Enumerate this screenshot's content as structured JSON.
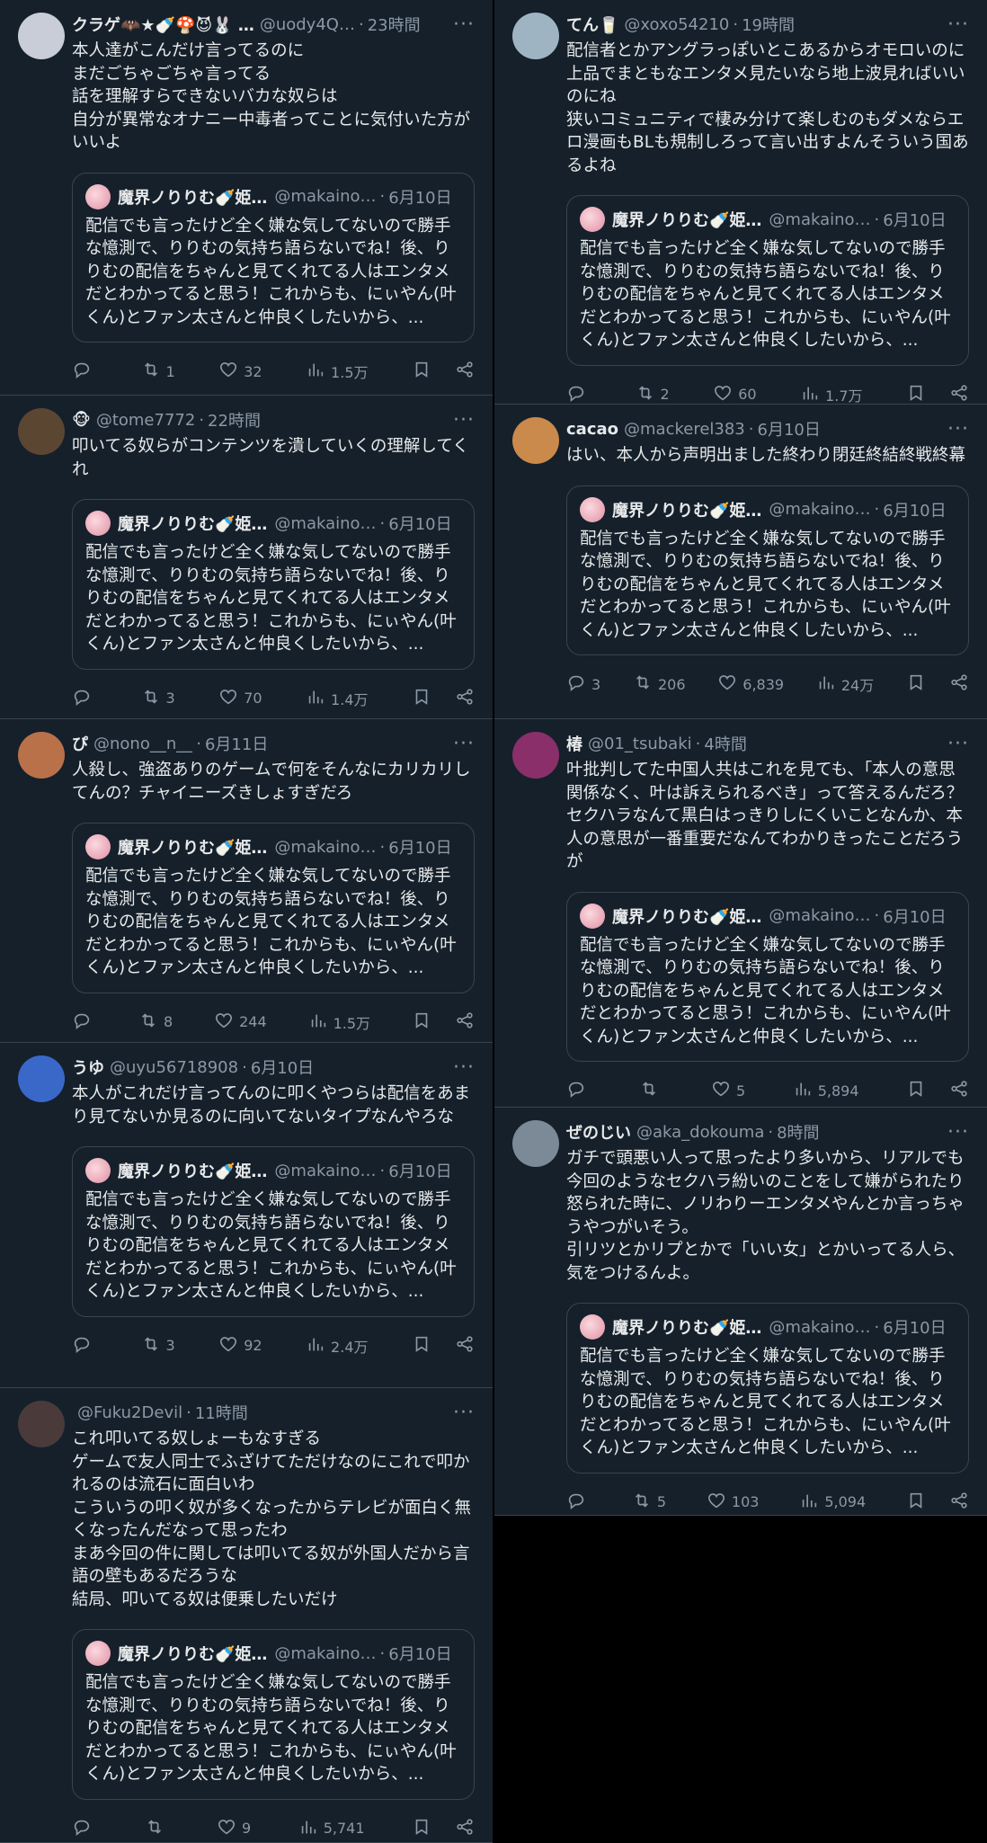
{
  "quote": {
    "name": "魔界ノりりむ🍼姫…",
    "handle": "@makaino…",
    "time": "6月10日",
    "body": "配信でも言ったけど全く嫌な気してないので勝手な憶測で、りりむの気持ち語らないでね！後、りりむの配信をちゃんと見てくれてる人はエンタメだとわかってると思う！これからも、にぃやん(叶くん)とファン太さんと仲良くしたいから、..."
  },
  "left_column": [
    {
      "name": "クラゲ🦇★🍼🍄😈🐰 …",
      "handle": "@uody4Q…",
      "time": "23時間",
      "avatar_color": "#c9cdd8",
      "body": "本人達がこんだけ言ってるのに\nまだごちゃごちゃ言ってる\n話を理解すらできないバカな奴らは\n自分が異常なオナニー中毒者ってことに気付いた方がいいよ",
      "replies": "",
      "retweets": "1",
      "likes": "32",
      "views": "1.5万"
    },
    {
      "name": "🐵",
      "handle": "@tome7772",
      "time": "22時間",
      "avatar_color": "#5b4632",
      "body": "叩いてる奴らがコンテンツを潰していくの理解してくれ",
      "replies": "",
      "retweets": "3",
      "likes": "70",
      "views": "1.4万"
    },
    {
      "name": "ぴ",
      "handle": "@nono__n__",
      "time": "6月11日",
      "avatar_color": "#b9714a",
      "body": "人殺し、強盗ありのゲームで何をそんなにカリカリしてんの？チャイニーズきしょすぎだろ",
      "replies": "",
      "retweets": "8",
      "likes": "244",
      "views": "1.5万"
    },
    {
      "name": "うゆ",
      "handle": "@uyu56718908",
      "time": "6月10日",
      "avatar_color": "#3a68c9",
      "body": "本人がこれだけ言ってんのに叩くやつらは配信をあまり見てないか見るのに向いてないタイプなんやろな",
      "replies": "",
      "retweets": "3",
      "likes": "92",
      "views": "2.4万"
    },
    {
      "name": "",
      "handle": "@Fuku2Devil",
      "time": "11時間",
      "avatar_color": "#4a3a3a",
      "body": "これ叩いてる奴しょーもなすぎる\nゲームで友人同士でふざけてただけなのにこれで叩かれるのは流石に面白いわ\nこういうの叩く奴が多くなったからテレビが面白く無くなったんだなって思ったわ\nまあ今回の件に関しては叩いてる奴が外国人だから言語の壁もあるだろうな\n結局、叩いてる奴は便乗したいだけ",
      "replies": "",
      "retweets": "",
      "likes": "9",
      "views": "5,741"
    }
  ],
  "right_column": [
    {
      "name": "てん🥛",
      "handle": "@xoxo54210",
      "time": "19時間",
      "avatar_color": "#9fb4c2",
      "body": "配信者とかアングラっぽいとこあるからオモロいのに上品でまともなエンタメ見たいなら地上波見ればいいのにね\n狭いコミュニティで棲み分けて楽しむのもダメならエロ漫画もBLも規制しろって言い出すよんそういう国あるよね",
      "replies": "",
      "retweets": "2",
      "likes": "60",
      "views": "1.7万"
    },
    {
      "name": "cacao",
      "handle": "@mackerel383",
      "time": "6月10日",
      "avatar_color": "#c98a4b",
      "body": "はい、本人から声明出ました終わり閉廷終結終戦終幕",
      "replies": "3",
      "retweets": "206",
      "likes": "6,839",
      "views": "24万"
    },
    {
      "name": "椿",
      "handle": "@01_tsubaki",
      "time": "4時間",
      "avatar_color": "#8a2f6a",
      "body": "叶批判してた中国人共はこれを見ても、「本人の意思関係なく、叶は訴えられるべき」って答えるんだろ？セクハラなんて黒白はっきりしにくいことなんか、本人の意思が一番重要だなんてわかりきったことだろうが",
      "replies": "",
      "retweets": "",
      "likes": "5",
      "views": "5,894"
    },
    {
      "name": "ぜのじい",
      "handle": "@aka_dokouma",
      "time": "8時間",
      "avatar_color": "#7c8a97",
      "body": "ガチで頭悪い人って思ったより多いから、リアルでも今回のようなセクハラ紛いのことをして嫌がられたり怒られた時に、ノリわりーエンタメやんとか言っちゃうやつがいそう。\n引リツとかリプとかで「いい女」とかいってる人ら、気をつけるんよ。",
      "replies": "",
      "retweets": "5",
      "likes": "103",
      "views": "5,094"
    }
  ]
}
